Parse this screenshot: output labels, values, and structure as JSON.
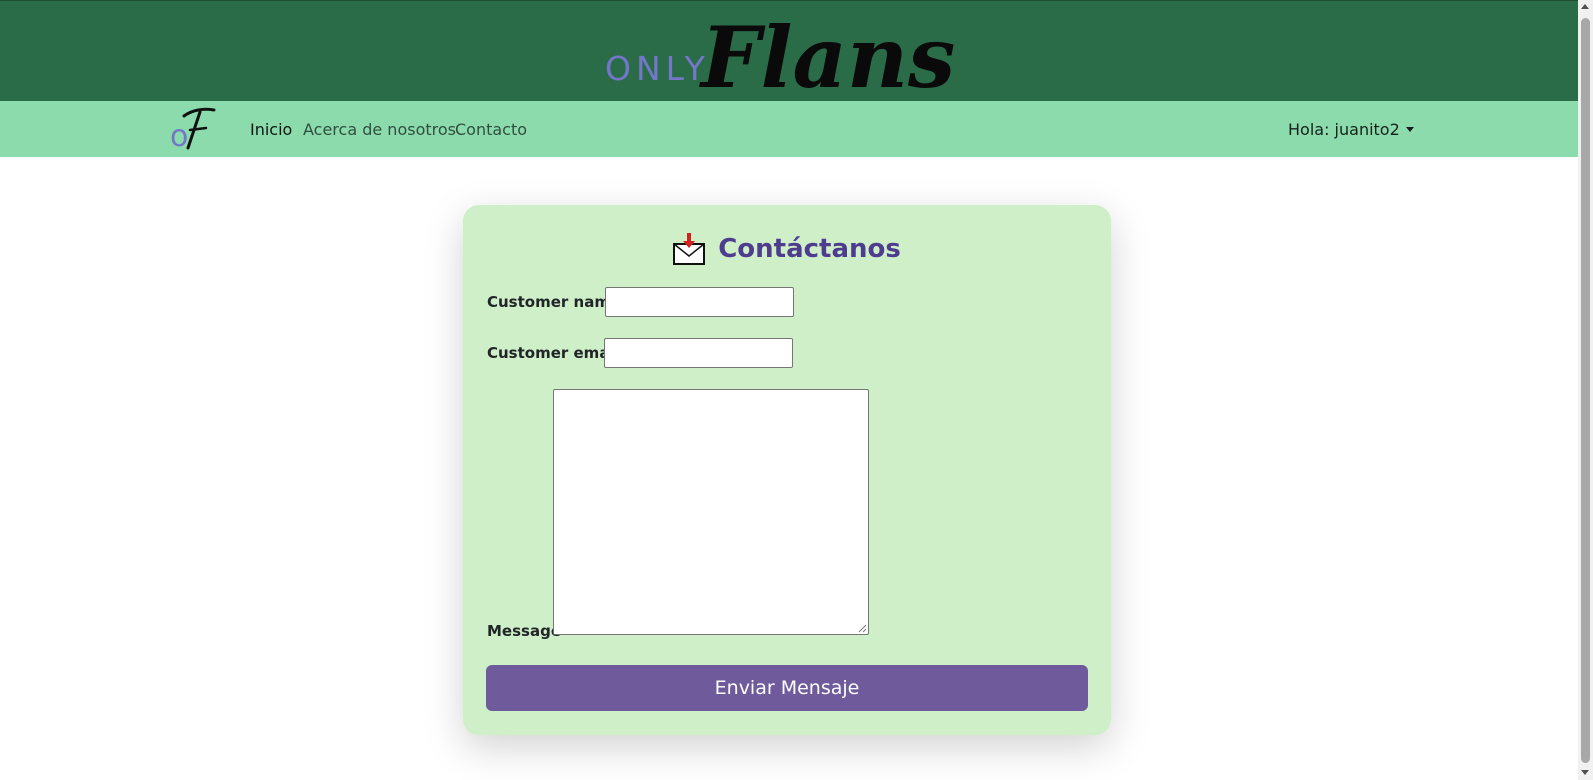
{
  "header": {
    "logo_only_text": "ONLY",
    "logo_script_text": "Flans"
  },
  "navbar": {
    "brand_icon": "of-monogram-logo",
    "links": [
      {
        "label": "Inicio",
        "active": true
      },
      {
        "label": "Acerca de nosotros",
        "active": false
      },
      {
        "label": "Contacto",
        "active": false
      }
    ],
    "user_menu_label": "Hola: juanito2"
  },
  "contact_form": {
    "title": "Contáctanos",
    "title_icon": "incoming-envelope-icon",
    "name_label": "Customer name",
    "name_value": "",
    "email_label": "Customer email",
    "email_value": "",
    "message_label": "Message",
    "message_value": "",
    "submit_label": "Enviar Mensaje"
  },
  "colors": {
    "banner": "#2a6b48",
    "navbar": "#8bdbad",
    "card": "#cfefc8",
    "title": "#4e3d8e",
    "button": "#6f5b9c",
    "logo_accent": "#7477c7"
  }
}
